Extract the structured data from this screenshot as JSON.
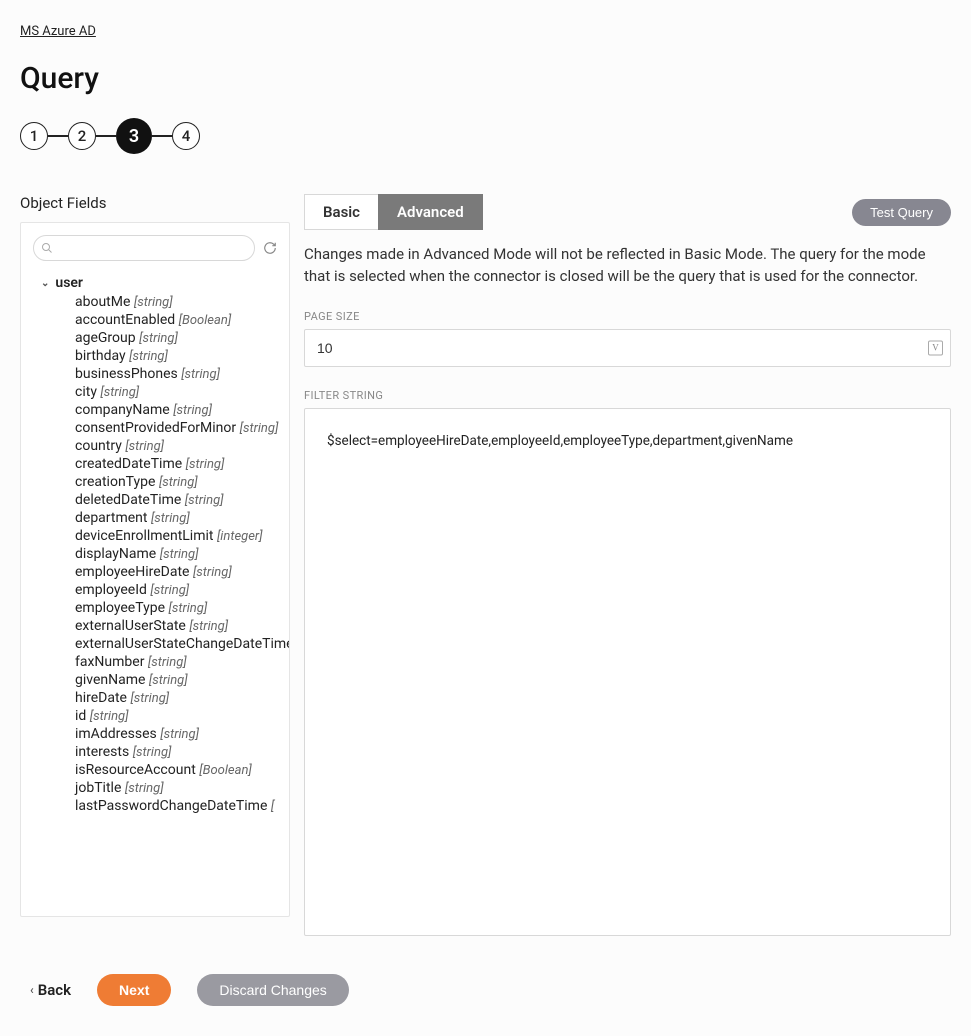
{
  "breadcrumb": "MS Azure AD",
  "pageTitle": "Query",
  "stepper": [
    "1",
    "2",
    "3",
    "4"
  ],
  "currentStep": 3,
  "left": {
    "label": "Object Fields",
    "searchPlaceholder": "",
    "root": "user",
    "fields": [
      {
        "name": "aboutMe",
        "type": "[string]"
      },
      {
        "name": "accountEnabled",
        "type": "[Boolean]"
      },
      {
        "name": "ageGroup",
        "type": "[string]"
      },
      {
        "name": "birthday",
        "type": "[string]"
      },
      {
        "name": "businessPhones",
        "type": "[string]"
      },
      {
        "name": "city",
        "type": "[string]"
      },
      {
        "name": "companyName",
        "type": "[string]"
      },
      {
        "name": "consentProvidedForMinor",
        "type": "[string]"
      },
      {
        "name": "country",
        "type": "[string]"
      },
      {
        "name": "createdDateTime",
        "type": "[string]"
      },
      {
        "name": "creationType",
        "type": "[string]"
      },
      {
        "name": "deletedDateTime",
        "type": "[string]"
      },
      {
        "name": "department",
        "type": "[string]"
      },
      {
        "name": "deviceEnrollmentLimit",
        "type": "[integer]"
      },
      {
        "name": "displayName",
        "type": "[string]"
      },
      {
        "name": "employeeHireDate",
        "type": "[string]"
      },
      {
        "name": "employeeId",
        "type": "[string]"
      },
      {
        "name": "employeeType",
        "type": "[string]"
      },
      {
        "name": "externalUserState",
        "type": "[string]"
      },
      {
        "name": "externalUserStateChangeDateTime",
        "type": ""
      },
      {
        "name": "faxNumber",
        "type": "[string]"
      },
      {
        "name": "givenName",
        "type": "[string]"
      },
      {
        "name": "hireDate",
        "type": "[string]"
      },
      {
        "name": "id",
        "type": "[string]"
      },
      {
        "name": "imAddresses",
        "type": "[string]"
      },
      {
        "name": "interests",
        "type": "[string]"
      },
      {
        "name": "isResourceAccount",
        "type": "[Boolean]"
      },
      {
        "name": "jobTitle",
        "type": "[string]"
      },
      {
        "name": "lastPasswordChangeDateTime",
        "type": "["
      }
    ]
  },
  "right": {
    "tabs": {
      "basic": "Basic",
      "advanced": "Advanced"
    },
    "testQuery": "Test Query",
    "info": "Changes made in Advanced Mode will not be reflected in Basic Mode. The query for the mode that is selected when the connector is closed will be the query that is used for the connector.",
    "pageSizeLabel": "PAGE SIZE",
    "pageSizeValue": "10",
    "filterLabel": "FILTER STRING",
    "filterValue": "$select=employeeHireDate,employeeId,employeeType,department,givenName"
  },
  "footer": {
    "back": "Back",
    "next": "Next",
    "discard": "Discard Changes"
  }
}
